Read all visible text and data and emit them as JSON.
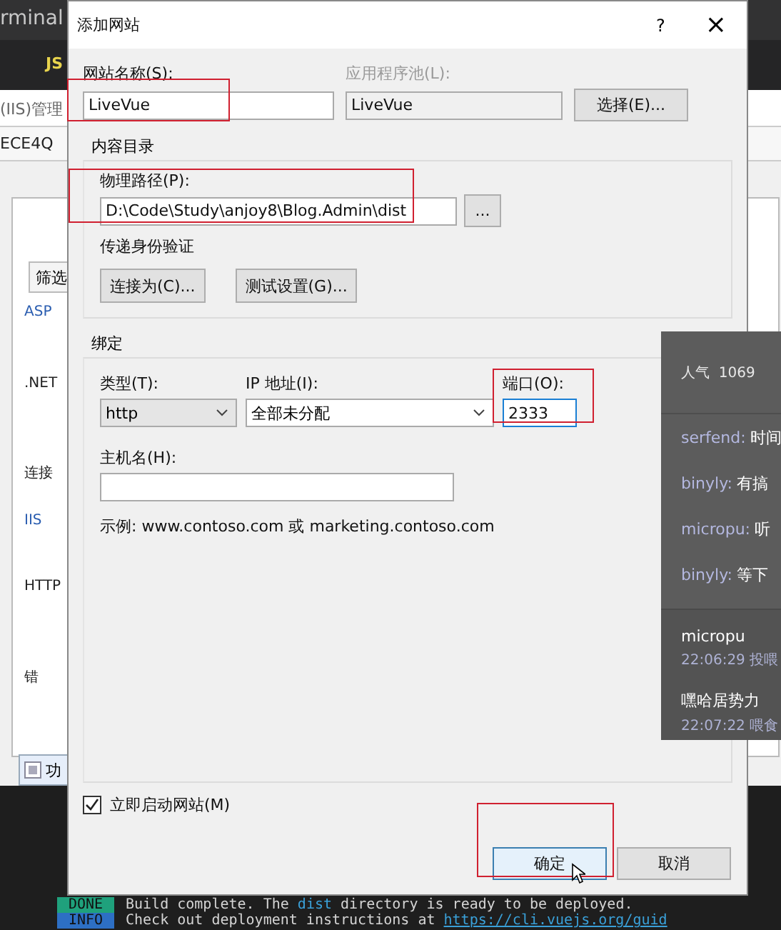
{
  "editor": {
    "tab_title": "rminal",
    "file_badge": "JS"
  },
  "iis_window": {
    "title": "(IIS)管理",
    "server": "ECE4Q",
    "filter_button": "筛选",
    "features": [
      {
        "label": "ASP",
        "kind": "link"
      },
      {
        "label": ".NET",
        "kind": "plain"
      },
      {
        "label": "连接",
        "kind": "plain"
      },
      {
        "label": "IIS",
        "kind": "link"
      },
      {
        "label": "HTTP",
        "kind": "plain"
      },
      {
        "label": "错",
        "kind": "plain"
      }
    ],
    "bottom_tab": "功"
  },
  "dialog": {
    "title": "添加网站",
    "help": "?",
    "close": "×",
    "site_name": {
      "label": "网站名称(S):",
      "value": "LiveVue"
    },
    "app_pool": {
      "label": "应用程序池(L):",
      "value": "LiveVue",
      "disabled": true
    },
    "select_button": "选择(E)...",
    "content_dir": {
      "group_label": "内容目录",
      "path_label": "物理路径(P):",
      "path_value": "D:\\Code\\Study\\anjoy8\\Blog.Admin\\dist",
      "browse_button": "...",
      "auth_label": "传递身份验证",
      "connect_button": "连接为(C)...",
      "test_button": "测试设置(G)..."
    },
    "binding": {
      "group_label": "绑定",
      "type": {
        "label": "类型(T):",
        "value": "http"
      },
      "ip": {
        "label": "IP 地址(I):",
        "value": "全部未分配"
      },
      "port": {
        "label": "端口(O):",
        "value": "2333",
        "focused": true
      },
      "host": {
        "label": "主机名(H):"
      },
      "example": "示例: www.contoso.com 或 marketing.contoso.com"
    },
    "start_now": {
      "label": "立即启动网站(M)",
      "checked": true
    },
    "ok_button": {
      "label": "确定",
      "default": true
    },
    "cancel_button": {
      "label": "取消",
      "default": false
    }
  },
  "chat_overlay": {
    "popularity_label": "人气",
    "popularity": "1069",
    "messages": [
      {
        "user": "serfend:",
        "text": "时间"
      },
      {
        "user": "binyly:",
        "text": "有搞"
      },
      {
        "user": "micropu:",
        "text": "听"
      },
      {
        "user": "binyly:",
        "text": "等下"
      }
    ],
    "gifts": [
      {
        "user": "micropu",
        "time": "22:06:29",
        "action": "投喂"
      },
      {
        "user": "嘿哈居势力",
        "time": "22:07:22",
        "action": "喂食"
      }
    ]
  },
  "terminal": {
    "lines": [
      {
        "tag": "DONE",
        "kind": "done",
        "parts": [
          {
            "text": "Build complete. The ",
            "kind": "plain"
          },
          {
            "text": "dist",
            "kind": "code"
          },
          {
            "text": " directory is ready to be deployed.",
            "kind": "plain"
          }
        ]
      },
      {
        "tag": "INFO",
        "kind": "info",
        "parts": [
          {
            "text": "Check out deployment instructions at ",
            "kind": "plain"
          },
          {
            "text": "https://cli.vuejs.org/guid",
            "kind": "link"
          }
        ]
      }
    ]
  }
}
